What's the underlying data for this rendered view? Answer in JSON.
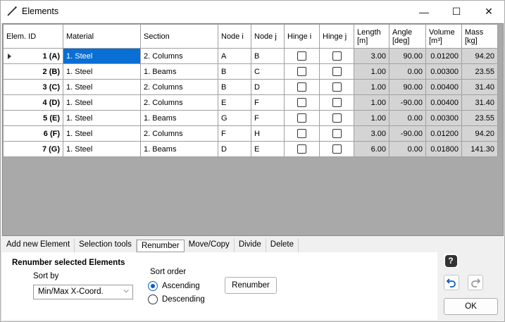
{
  "window": {
    "title": "Elements",
    "minimize": "—",
    "maximize": "☐",
    "close": "✕"
  },
  "columns": [
    {
      "label": "Elem. ID"
    },
    {
      "label": "Material"
    },
    {
      "label": "Section"
    },
    {
      "label": "Node i"
    },
    {
      "label": "Node j"
    },
    {
      "label": "Hinge i"
    },
    {
      "label": "Hinge j"
    },
    {
      "label": "Length\n[m]"
    },
    {
      "label": "Angle\n[deg]"
    },
    {
      "label": "Volume\n[m³]"
    },
    {
      "label": "Mass\n[kg]"
    }
  ],
  "rows": [
    {
      "id": "1 (A)",
      "material": "1. Steel",
      "section": "2. Columns",
      "node_i": "A",
      "node_j": "B",
      "hinge_i": false,
      "hinge_j": false,
      "length": "3.00",
      "angle": "90.00",
      "volume": "0.01200",
      "mass": "94.20"
    },
    {
      "id": "2 (B)",
      "material": "1. Steel",
      "section": "1. Beams",
      "node_i": "B",
      "node_j": "C",
      "hinge_i": false,
      "hinge_j": false,
      "length": "1.00",
      "angle": "0.00",
      "volume": "0.00300",
      "mass": "23.55"
    },
    {
      "id": "3 (C)",
      "material": "1. Steel",
      "section": "2. Columns",
      "node_i": "B",
      "node_j": "D",
      "hinge_i": false,
      "hinge_j": false,
      "length": "1.00",
      "angle": "90.00",
      "volume": "0.00400",
      "mass": "31.40"
    },
    {
      "id": "4 (D)",
      "material": "1. Steel",
      "section": "2. Columns",
      "node_i": "E",
      "node_j": "F",
      "hinge_i": false,
      "hinge_j": false,
      "length": "1.00",
      "angle": "-90.00",
      "volume": "0.00400",
      "mass": "31.40"
    },
    {
      "id": "5 (E)",
      "material": "1. Steel",
      "section": "1. Beams",
      "node_i": "G",
      "node_j": "F",
      "hinge_i": false,
      "hinge_j": false,
      "length": "1.00",
      "angle": "0.00",
      "volume": "0.00300",
      "mass": "23.55"
    },
    {
      "id": "6 (F)",
      "material": "1. Steel",
      "section": "2. Columns",
      "node_i": "F",
      "node_j": "H",
      "hinge_i": false,
      "hinge_j": false,
      "length": "3.00",
      "angle": "-90.00",
      "volume": "0.01200",
      "mass": "94.20"
    },
    {
      "id": "7 (G)",
      "material": "1. Steel",
      "section": "1. Beams",
      "node_i": "D",
      "node_j": "E",
      "hinge_i": false,
      "hinge_j": false,
      "length": "6.00",
      "angle": "0.00",
      "volume": "0.01800",
      "mass": "141.30"
    }
  ],
  "tabs": [
    "Add new Element",
    "Selection tools",
    "Renumber",
    "Move/Copy",
    "Divide",
    "Delete"
  ],
  "active_tab": "Renumber",
  "renumber": {
    "heading": "Renumber selected Elements",
    "sort_by_label": "Sort by",
    "sort_by_value": "Min/Max X-Coord.",
    "sort_order_label": "Sort order",
    "ascending": "Ascending",
    "descending": "Descending",
    "button": "Renumber"
  },
  "buttons": {
    "ok": "OK",
    "help": "?"
  },
  "colors": {
    "selected_cell": "#0a6fd4",
    "readonly_cell": "#d4d4d4",
    "grid_empty": "#a9a9a9",
    "radio_accent": "#0a5fc2"
  },
  "icons": [
    "line-element-icon",
    "help-icon",
    "undo-icon",
    "redo-icon"
  ]
}
